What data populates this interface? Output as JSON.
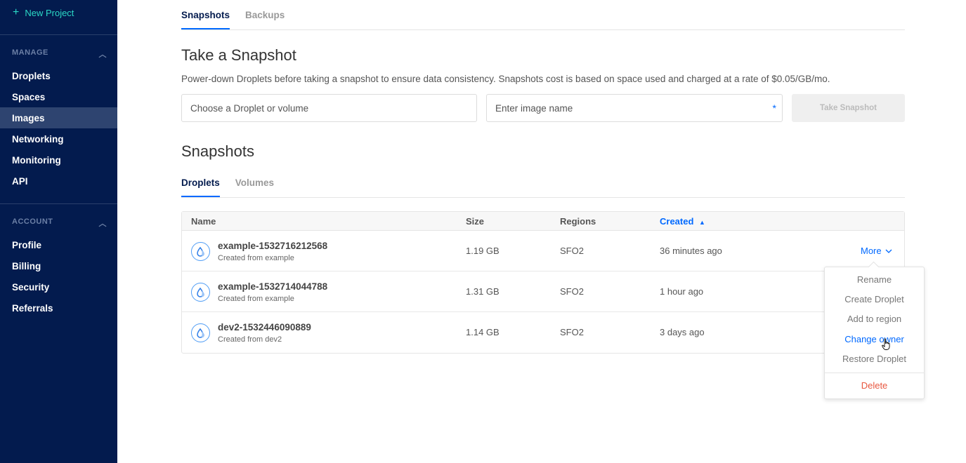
{
  "sidebar": {
    "new_project": "New Project",
    "sections": [
      {
        "title": "MANAGE",
        "items": [
          {
            "label": "Droplets",
            "active": false
          },
          {
            "label": "Spaces",
            "active": false
          },
          {
            "label": "Images",
            "active": true
          },
          {
            "label": "Networking",
            "active": false
          },
          {
            "label": "Monitoring",
            "active": false
          },
          {
            "label": "API",
            "active": false
          }
        ]
      },
      {
        "title": "ACCOUNT",
        "items": [
          {
            "label": "Profile",
            "active": false
          },
          {
            "label": "Billing",
            "active": false
          },
          {
            "label": "Security",
            "active": false
          },
          {
            "label": "Referrals",
            "active": false
          }
        ]
      }
    ]
  },
  "top_tabs": [
    {
      "label": "Snapshots",
      "active": true
    },
    {
      "label": "Backups",
      "active": false
    }
  ],
  "take_snapshot": {
    "title": "Take a Snapshot",
    "description": "Power-down Droplets before taking a snapshot to ensure data consistency. Snapshots cost is based on space used and charged at a rate of $0.05/GB/mo.",
    "droplet_select_placeholder": "Choose a Droplet or volume",
    "image_name_placeholder": "Enter image name",
    "required_marker": "*",
    "button_label": "Take Snapshot"
  },
  "snapshots": {
    "title": "Snapshots",
    "tabs": [
      {
        "label": "Droplets",
        "active": true
      },
      {
        "label": "Volumes",
        "active": false
      }
    ],
    "columns": {
      "name": "Name",
      "size": "Size",
      "regions": "Regions",
      "created": "Created"
    },
    "sort_indicator": "▲",
    "rows": [
      {
        "name": "example-1532716212568",
        "sub": "Created from example",
        "size": "1.19 GB",
        "region": "SFO2",
        "created": "36 minutes ago"
      },
      {
        "name": "example-1532714044788",
        "sub": "Created from example",
        "size": "1.31 GB",
        "region": "SFO2",
        "created": "1 hour ago"
      },
      {
        "name": "dev2-1532446090889",
        "sub": "Created from dev2",
        "size": "1.14 GB",
        "region": "SFO2",
        "created": "3 days ago"
      }
    ],
    "more_label": "More"
  },
  "more_menu": {
    "items": [
      "Rename",
      "Create Droplet",
      "Add to region",
      "Change owner",
      "Restore Droplet"
    ],
    "hovered": "Change owner",
    "danger_item": "Delete"
  },
  "colors": {
    "sidebar_bg": "#031b4e",
    "accent": "#0069ff",
    "new_project": "#2bd9c6",
    "danger": "#e8573f"
  }
}
